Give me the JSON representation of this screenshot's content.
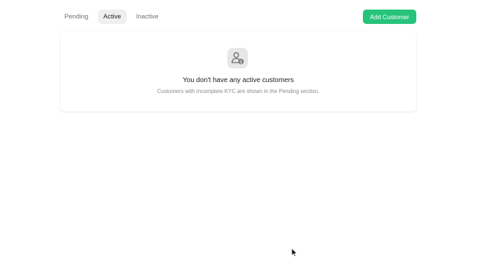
{
  "tabs": [
    {
      "label": "Pending",
      "active": false
    },
    {
      "label": "Active",
      "active": true
    },
    {
      "label": "Inactive",
      "active": false
    }
  ],
  "toolbar": {
    "add_customer_label": "Add Customer"
  },
  "empty_state": {
    "icon": "user-dollar-icon",
    "title": "You don't have any active customers",
    "subtitle": "Customers with incomplete KYC are shown in the Pending section."
  },
  "colors": {
    "accent": "#27c37b",
    "active_tab_bg": "#efefef"
  }
}
